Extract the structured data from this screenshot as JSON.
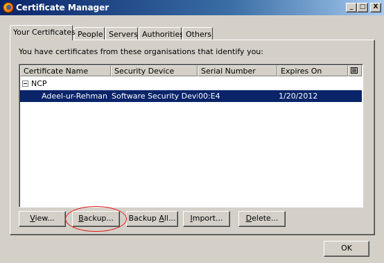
{
  "window": {
    "title": "Certificate Manager",
    "controls": {
      "minimize": "_",
      "maximize": "□",
      "close": "X"
    }
  },
  "tabs": [
    {
      "label": "Your Certificates",
      "active": true
    },
    {
      "label": "People",
      "active": false
    },
    {
      "label": "Servers",
      "active": false
    },
    {
      "label": "Authorities",
      "active": false
    },
    {
      "label": "Others",
      "active": false
    }
  ],
  "panel": {
    "description": "You have certificates from these organisations that identify you:",
    "columns": [
      "Certificate Name",
      "Security Device",
      "Serial Number",
      "Expires On"
    ],
    "groups": [
      {
        "name": "NCP",
        "expanded": true,
        "rows": [
          {
            "certificate_name": "Adeel-ur-Rehman",
            "security_device": "Software Security Devi...",
            "serial_number": "00:E4",
            "expires_on": "1/20/2012",
            "selected": true
          }
        ]
      }
    ],
    "buttons": {
      "view": {
        "mnemonic": "V",
        "rest": "iew..."
      },
      "backup": {
        "mnemonic": "B",
        "rest": "ackup..."
      },
      "backup_all": {
        "pre": "Backup ",
        "mnemonic": "A",
        "rest": "ll..."
      },
      "import": {
        "mnemonic": "I",
        "rest": "mport..."
      },
      "delete": {
        "mnemonic": "D",
        "rest": "elete..."
      }
    }
  },
  "ok_label": "OK",
  "colors": {
    "selection": "#0a246a",
    "highlight_annotation": "#e01818"
  }
}
